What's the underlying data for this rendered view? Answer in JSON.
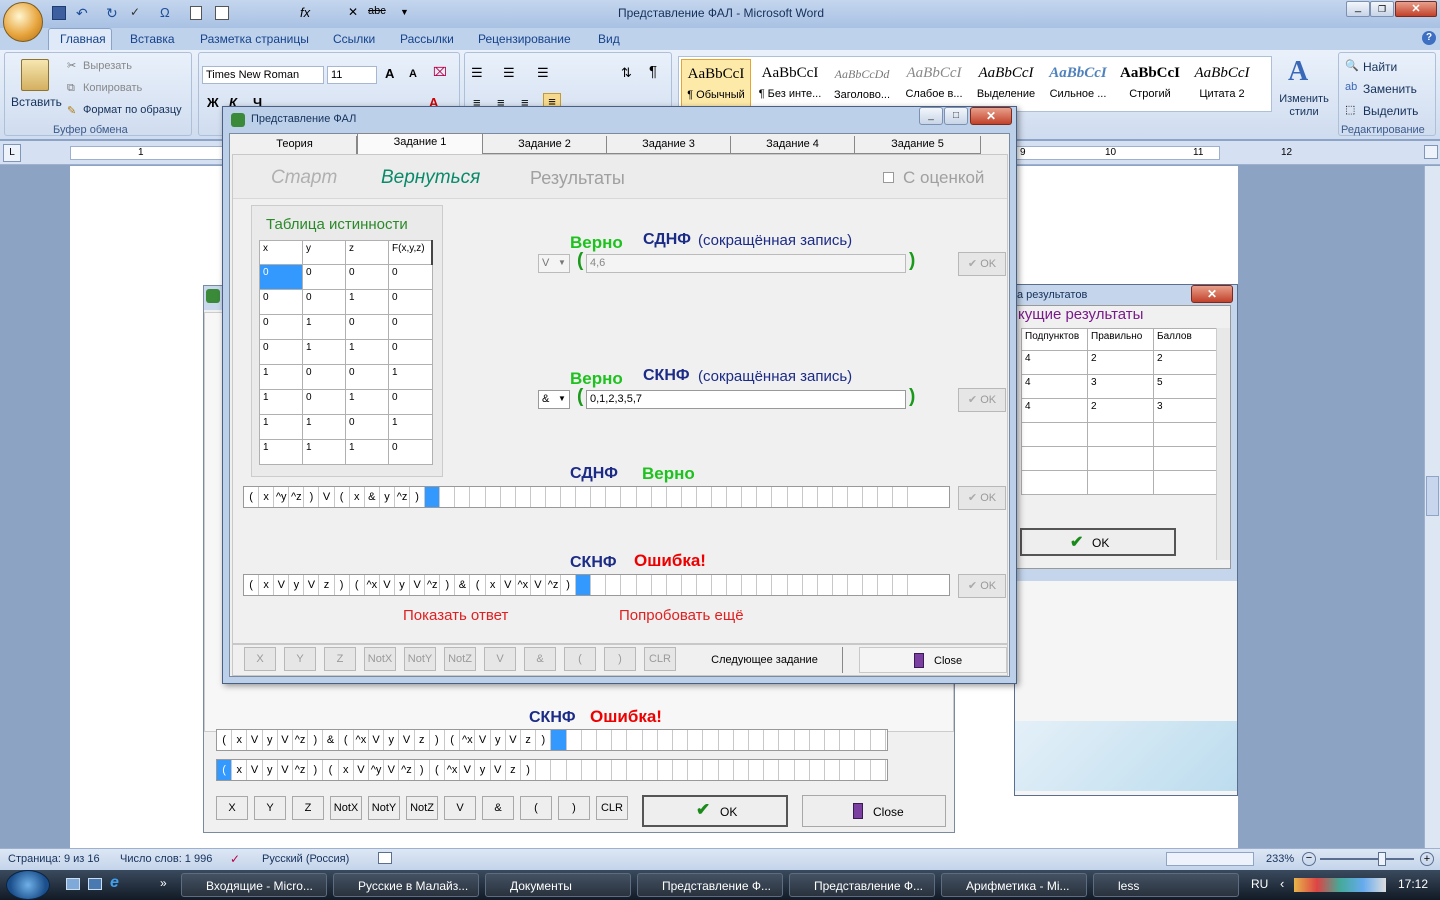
{
  "word": {
    "title": "Представление ФАЛ - Microsoft Word",
    "tabs": [
      "Главная",
      "Вставка",
      "Разметка страницы",
      "Ссылки",
      "Рассылки",
      "Рецензирование",
      "Вид"
    ],
    "clipboard": {
      "paste": "Вставить",
      "cut": "Вырезать",
      "copy": "Копировать",
      "format_painter": "Формат по образцу",
      "group": "Буфер обмена"
    },
    "font_name": "Times New Roman",
    "font_size": "11",
    "styles": [
      {
        "preview": "AaBbCcI",
        "name": "¶ Обычный"
      },
      {
        "preview": "AaBbCcI",
        "name": "¶ Без инте..."
      },
      {
        "preview": "AaBbCcDd",
        "name": "Заголово..."
      },
      {
        "preview": "AaBbCcI",
        "name": "Слабое в..."
      },
      {
        "preview": "AaBbCcI",
        "name": "Выделение"
      },
      {
        "preview": "AaBbCcI",
        "name": "Сильное ..."
      },
      {
        "preview": "AaBbCcI",
        "name": "Строгий"
      },
      {
        "preview": "AaBbCcI",
        "name": "Цитата 2"
      }
    ],
    "change_styles": "Изменить стили",
    "editing": {
      "find": "Найти",
      "replace": "Заменить",
      "select": "Выделить",
      "group": "Редактирование"
    },
    "ruler_right": [
      "9",
      "10",
      "11",
      "12"
    ],
    "ruler_left": [
      "1"
    ],
    "status": {
      "page": "Страница: 9 из 16",
      "words": "Число слов: 1 996",
      "lang": "Русский (Россия)",
      "zoom": "233%"
    }
  },
  "taskbar": {
    "items": [
      "Входящие - Micro...",
      "Русские в Малайз...",
      "Документы",
      "Представление Ф...",
      "Представление Ф...",
      "Арифметика - Mi...",
      "less"
    ],
    "lang": "RU",
    "clock": "17:12"
  },
  "results_window": {
    "title": "а результатов",
    "heading": "кущие результаты",
    "columns": [
      "Подпунктов",
      "Правильно",
      "Баллов"
    ],
    "rows": [
      [
        "4",
        "2",
        "2"
      ],
      [
        "4",
        "3",
        "5"
      ],
      [
        "4",
        "2",
        "3"
      ]
    ],
    "ok": "OK"
  },
  "bg_window": {
    "label_sknf": "СКНФ",
    "label_error": "Ошибка!",
    "row1": [
      "(",
      "x",
      "V",
      "y",
      "V",
      "^z",
      ")",
      "&",
      "(",
      "^x",
      "V",
      "y",
      "V",
      "z",
      ")",
      "(",
      "^x",
      "V",
      "y",
      "V",
      "z",
      ")"
    ],
    "row2": [
      "(",
      "x",
      "V",
      "y",
      "V",
      "^z",
      ")",
      "(",
      "x",
      "V",
      "^y",
      "V",
      "^z",
      ")",
      "(",
      "^x",
      "V",
      "y",
      "V",
      "z",
      ")"
    ],
    "buttons": [
      "X",
      "Y",
      "Z",
      "NotX",
      "NotY",
      "NotZ",
      "V",
      "&",
      "(",
      ")",
      "CLR"
    ],
    "ok": "OK",
    "close": "Close"
  },
  "fal": {
    "title": "Представление ФАЛ",
    "tabs": [
      "Теория",
      "Задание 1",
      "Задание 2",
      "Задание 3",
      "Задание 4",
      "Задание 5"
    ],
    "start": "Старт",
    "back": "Вернуться",
    "results": "Результаты",
    "with_grade": "С оценкой",
    "truth_table_title": "Таблица истинности",
    "truth_header": [
      "x",
      "y",
      "z",
      "F(x,y,z)"
    ],
    "truth_rows": [
      [
        "0",
        "0",
        "0",
        "0"
      ],
      [
        "0",
        "0",
        "1",
        "0"
      ],
      [
        "0",
        "1",
        "0",
        "0"
      ],
      [
        "0",
        "1",
        "1",
        "0"
      ],
      [
        "1",
        "0",
        "0",
        "1"
      ],
      [
        "1",
        "0",
        "1",
        "0"
      ],
      [
        "1",
        "1",
        "0",
        "1"
      ],
      [
        "1",
        "1",
        "1",
        "0"
      ]
    ],
    "correct": "Верно",
    "sdnf": "СДНФ",
    "sknf": "СКНФ",
    "short_note": "(сокращённая запись)",
    "sdnf_op": "V",
    "sdnf_value": "4,6",
    "sknf_op": "&",
    "sknf_value": "0,1,2,3,5,7",
    "open_paren": "(",
    "close_paren": ")",
    "ok": "OK",
    "error": "Ошибка!",
    "sdnf_expr": [
      "(",
      "x",
      "^y",
      "^z",
      ")",
      "V",
      "(",
      "x",
      "&",
      "y",
      "^z",
      ")"
    ],
    "sknf_expr": [
      "(",
      "x",
      "V",
      "y",
      "V",
      "z",
      ")",
      "(",
      "^x",
      "V",
      "y",
      "V",
      "^z",
      ")",
      "&",
      "(",
      "x",
      "V",
      "^x",
      "V",
      "^z",
      ")"
    ],
    "show_answer": "Показать ответ",
    "try_again": "Попробовать ещё",
    "buttons": [
      "X",
      "Y",
      "Z",
      "NotX",
      "NotY",
      "NotZ",
      "V",
      "&",
      "(",
      ")",
      "CLR"
    ],
    "next_task": "Следующее задание",
    "close": "Close"
  }
}
